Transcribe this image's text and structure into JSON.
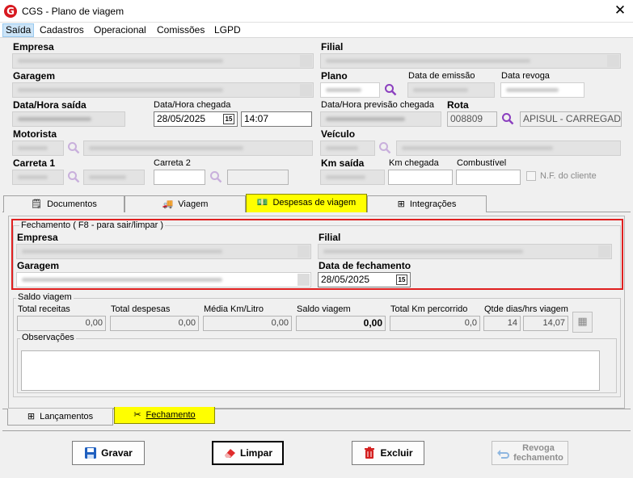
{
  "window": {
    "title": "CGS - Plano de viagem",
    "logo_letter": "G"
  },
  "menu": [
    "Saída",
    "Cadastros",
    "Operacional",
    "Comissões",
    "LGPD"
  ],
  "header": {
    "empresa_label": "Empresa",
    "filial_label": "Filial",
    "garagem_label": "Garagem",
    "plano_label": "Plano",
    "data_emissao_label": "Data de emissão",
    "data_revoga_label": "Data revoga",
    "data_saida_label": "Data/Hora saída",
    "data_chegada_label": "Data/Hora chegada",
    "data_chegada_value": "28/05/2025",
    "hora_chegada_value": "14:07",
    "previsao_label": "Data/Hora previsão chegada",
    "rota_label": "Rota",
    "rota_code": "008809",
    "rota_desc": "APISUL - CARREGADO -",
    "motorista_label": "Motorista",
    "veiculo_label": "Veículo",
    "carreta1_label": "Carreta 1",
    "carreta2_label": "Carreta 2",
    "km_saida_label": "Km saída",
    "km_chegada_label": "Km chegada",
    "combustivel_label": "Combustível",
    "nf_cliente_label": "N.F. do cliente"
  },
  "tabs": [
    "Documentos",
    "Viagem",
    "Despesas de viagem",
    "Integrações"
  ],
  "fechamento": {
    "legend": "Fechamento ( F8 - para sair/limpar )",
    "empresa_label": "Empresa",
    "filial_label": "Filial",
    "garagem_label": "Garagem",
    "data_fechamento_label": "Data de fechamento",
    "data_fechamento_value": "28/05/2025"
  },
  "saldo": {
    "legend": "Saldo viagem",
    "total_receitas_label": "Total receitas",
    "total_receitas": "0,00",
    "total_despesas_label": "Total despesas",
    "total_despesas": "0,00",
    "media_label": "Média Km/Litro",
    "media": "0,00",
    "saldo_label": "Saldo viagem",
    "saldo": "0,00",
    "km_label": "Total Km percorrido",
    "km": "0,0",
    "qtde_label": "Qtde dias/hrs viagem",
    "dias": "14",
    "hrs": "14,07"
  },
  "observacoes_label": "Observações",
  "bottom_tabs": [
    "Lançamentos",
    "Fechamento"
  ],
  "buttons": {
    "gravar": "Gravar",
    "limpar": "Limpar",
    "excluir": "Excluir",
    "revoga_1": "Revoga",
    "revoga_2": "fechamento"
  },
  "colors": {
    "highlight_border": "#e02020",
    "selected_tab": "#ffff00",
    "logo": "#d71920"
  }
}
